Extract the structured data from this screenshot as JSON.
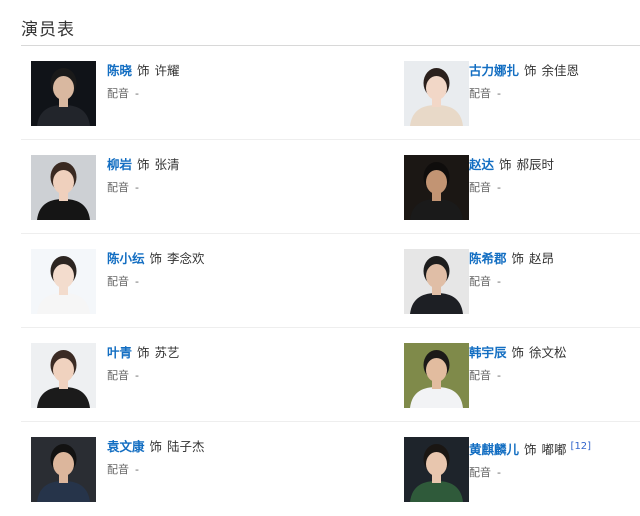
{
  "section_title": "演员表",
  "cast": [
    {
      "actor": "陈晓",
      "connector": "饰",
      "role": "许耀",
      "dub_label": "配音",
      "dub_value": "-",
      "bg": "#101318",
      "skin": "#d9b8a0",
      "hair": "#1a1a1a",
      "cloth": "#22252b",
      "photo": "actor-photo-chen-xiao"
    },
    {
      "actor": "古力娜扎",
      "connector": "饰",
      "role": "余佳恩",
      "dub_label": "配音",
      "dub_value": "-",
      "bg": "#e9ecef",
      "skin": "#f2d7c7",
      "hair": "#2b211d",
      "cloth": "#e8d9c8",
      "photo": "actor-photo-gulinazha"
    },
    {
      "actor": "柳岩",
      "connector": "饰",
      "role": "张清",
      "dub_label": "配音",
      "dub_value": "-",
      "bg": "#cdd0d4",
      "skin": "#efd0bd",
      "hair": "#3a2a22",
      "cloth": "#151515",
      "photo": "actor-photo-liu-yan"
    },
    {
      "actor": "赵达",
      "connector": "饰",
      "role": "郝辰时",
      "dub_label": "配音",
      "dub_value": "-",
      "bg": "#1b1714",
      "skin": "#c29473",
      "hair": "#0f0d0c",
      "cloth": "#1a1a1a",
      "photo": "actor-photo-zhao-da"
    },
    {
      "actor": "陈小纭",
      "connector": "饰",
      "role": "李念欢",
      "dub_label": "配音",
      "dub_value": "-",
      "bg": "#f4f7fa",
      "skin": "#f3dccd",
      "hair": "#2c2521",
      "cloth": "#f6f6f6",
      "photo": "actor-photo-chen-xiaoyun"
    },
    {
      "actor": "陈希郡",
      "connector": "饰",
      "role": "赵昂",
      "dub_label": "配音",
      "dub_value": "-",
      "bg": "#e6e6e6",
      "skin": "#e0bea6",
      "hair": "#1d1d1d",
      "cloth": "#1d1f24",
      "photo": "actor-photo-chen-xijun"
    },
    {
      "actor": "叶青",
      "connector": "饰",
      "role": "苏艺",
      "dub_label": "配音",
      "dub_value": "-",
      "bg": "#eef0f2",
      "skin": "#f0d2bf",
      "hair": "#3b2b24",
      "cloth": "#1b1b1b",
      "photo": "actor-photo-ye-qing"
    },
    {
      "actor": "韩宇辰",
      "connector": "饰",
      "role": "徐文松",
      "dub_label": "配音",
      "dub_value": "-",
      "bg": "#7f8a4a",
      "skin": "#e2bc9f",
      "hair": "#1c1a18",
      "cloth": "#f2f3f5",
      "photo": "actor-photo-han-yuchen"
    },
    {
      "actor": "袁文康",
      "connector": "饰",
      "role": "陆子杰",
      "dub_label": "配音",
      "dub_value": "-",
      "bg": "#2a2d33",
      "skin": "#dcb69c",
      "hair": "#121212",
      "cloth": "#26344a",
      "photo": "actor-photo-yuan-wenkang"
    },
    {
      "actor": "黄麒麟儿",
      "connector": "饰",
      "role": "嘟嘟",
      "dub_label": "配音",
      "dub_value": "-",
      "ref": "[12]",
      "bg": "#1e242b",
      "skin": "#e8c6ae",
      "hair": "#1a1613",
      "cloth": "#2f5a3a",
      "photo": "actor-photo-huang-qilin"
    }
  ]
}
